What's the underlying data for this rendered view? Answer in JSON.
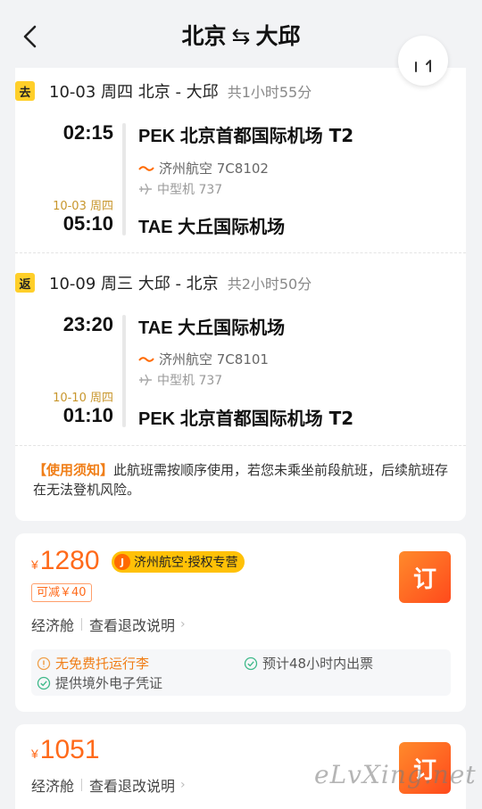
{
  "header": {
    "title_from": "北京",
    "title_swap": "⇆",
    "title_to": "大邱"
  },
  "outbound": {
    "tag": "去",
    "date": "10-03 周四 北京 - 大邱",
    "duration": "共1小时55分",
    "dep_time": "02:15",
    "dep_airport_code": "PEK",
    "dep_airport_name": "北京首都国际机场 T2",
    "airline": "济州航空 7C8102",
    "aircraft": "中型机 737",
    "arr_date": "10-03 周四",
    "arr_time": "05:10",
    "arr_airport_code": "TAE",
    "arr_airport_name": "大丘国际机场"
  },
  "return": {
    "tag": "返",
    "date": "10-09 周三 大邱 - 北京",
    "duration": "共2小时50分",
    "dep_time": "23:20",
    "dep_airport_code": "TAE",
    "dep_airport_name": "大丘国际机场",
    "airline": "济州航空 7C8101",
    "aircraft": "中型机 737",
    "arr_date": "10-10 周四",
    "arr_time": "01:10",
    "arr_airport_code": "PEK",
    "arr_airport_name": "北京首都国际机场 T2"
  },
  "notice": {
    "label": "【使用须知】",
    "text": "此航班需按顺序使用，若您未乘坐前段航班，后续航班存在无法登机风险。"
  },
  "offers": [
    {
      "currency": "¥",
      "price": "1280",
      "badge": "济州航空·授权专营",
      "badge_icon": "J",
      "discount": "可减￥40",
      "cabin": "经济舱",
      "refund_link": "查看退改说明",
      "chevron": "›",
      "book_label": "订",
      "info_warn": "无免费托运行李",
      "info_ticket": "预计48小时内出票",
      "info_voucher": "提供境外电子凭证"
    },
    {
      "currency": "¥",
      "price": "1051",
      "cabin": "经济舱",
      "refund_link": "查看退改说明",
      "chevron": "›",
      "book_label": "订"
    }
  ],
  "watermark": "eLvXing.net",
  "colors": {
    "accent_orange": "#ff6a1a",
    "tag_yellow": "#ffcf2a",
    "next_day_gold": "#c8962c"
  },
  "icons": {
    "back": "back-arrow-icon",
    "share": "share-icon",
    "airline_logo": "jejuair-logo-icon",
    "plane": "plane-icon",
    "warn": "info-circle-icon",
    "check": "check-circle-icon"
  }
}
